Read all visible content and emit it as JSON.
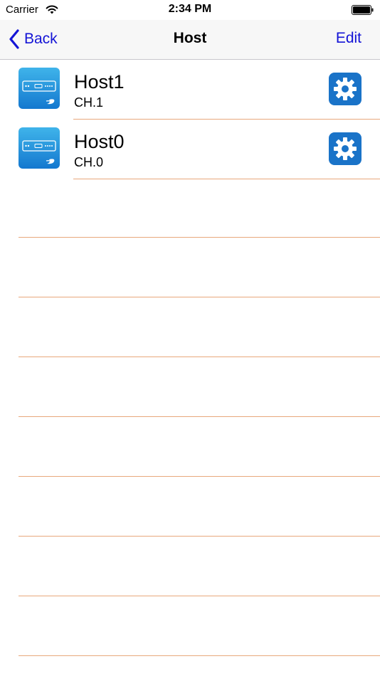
{
  "status_bar": {
    "carrier": "Carrier",
    "time": "2:34 PM"
  },
  "nav": {
    "back_label": "Back",
    "title": "Host",
    "edit_label": "Edit"
  },
  "hosts": [
    {
      "name": "Host1",
      "channel": "CH.1"
    },
    {
      "name": "Host0",
      "channel": "CH.0"
    }
  ],
  "colors": {
    "accent": "#1414d6",
    "gear_bg": "#1a73c8",
    "separator": "#e8a87c",
    "device_icon_top": "#3fb4ea",
    "device_icon_bottom": "#1478cf"
  },
  "icons": {
    "back": "chevron-left-icon",
    "settings": "gear-icon",
    "device": "blu-ray-player-icon",
    "wifi": "wifi-icon",
    "battery": "battery-icon"
  }
}
